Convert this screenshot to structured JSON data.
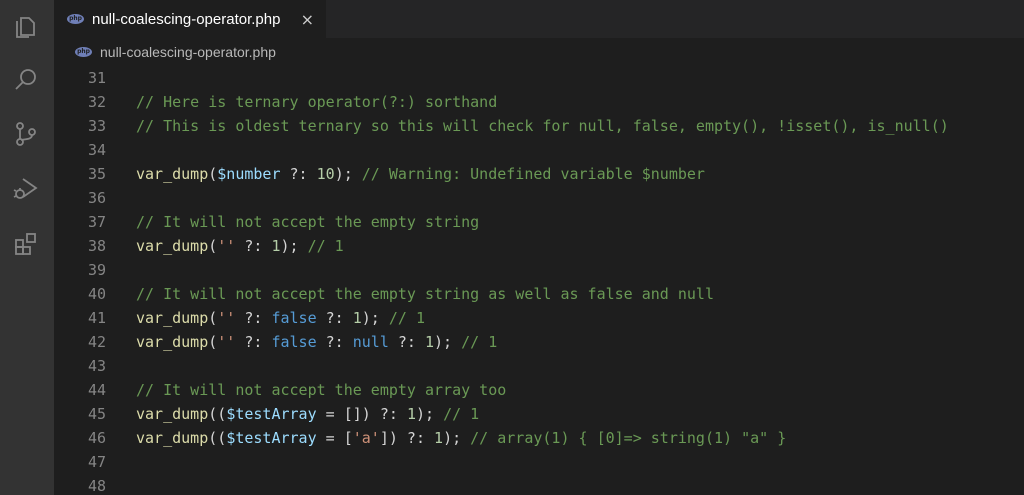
{
  "activity_bar": {
    "icons": [
      "files-icon",
      "search-icon",
      "source-control-icon",
      "run-debug-icon",
      "extensions-icon"
    ]
  },
  "tab": {
    "label": "null-coalescing-operator.php",
    "file_icon_text": "php",
    "close": "×"
  },
  "breadcrumb": {
    "label": "null-coalescing-operator.php",
    "file_icon_text": "php"
  },
  "colors": {
    "comment": "#6a9955",
    "function": "#dcdcaa",
    "variable": "#9cdcfe",
    "number": "#b5cea8",
    "string": "#ce9178",
    "keyword": "#569cd6",
    "text": "#d4d4d4",
    "line_number": "#858585"
  },
  "editor": {
    "lines": [
      {
        "num": "31",
        "tokens": []
      },
      {
        "num": "32",
        "tokens": [
          {
            "t": "comment",
            "v": "// Here is ternary operator(?:) sorthand"
          }
        ]
      },
      {
        "num": "33",
        "tokens": [
          {
            "t": "comment",
            "v": "// This is oldest ternary so this will check for null, false, empty(), !isset(), is_null()"
          }
        ]
      },
      {
        "num": "34",
        "tokens": []
      },
      {
        "num": "35",
        "tokens": [
          {
            "t": "func",
            "v": "var_dump"
          },
          {
            "t": "punc",
            "v": "("
          },
          {
            "t": "var",
            "v": "$number"
          },
          {
            "t": "punc",
            "v": " ?: "
          },
          {
            "t": "num",
            "v": "10"
          },
          {
            "t": "punc",
            "v": "); "
          },
          {
            "t": "comment",
            "v": "// Warning: Undefined variable $number"
          }
        ]
      },
      {
        "num": "36",
        "tokens": []
      },
      {
        "num": "37",
        "tokens": [
          {
            "t": "comment",
            "v": "// It will not accept the empty string"
          }
        ]
      },
      {
        "num": "38",
        "tokens": [
          {
            "t": "func",
            "v": "var_dump"
          },
          {
            "t": "punc",
            "v": "("
          },
          {
            "t": "str",
            "v": "''"
          },
          {
            "t": "punc",
            "v": " ?: "
          },
          {
            "t": "num",
            "v": "1"
          },
          {
            "t": "punc",
            "v": "); "
          },
          {
            "t": "comment",
            "v": "// 1"
          }
        ]
      },
      {
        "num": "39",
        "tokens": []
      },
      {
        "num": "40",
        "tokens": [
          {
            "t": "comment",
            "v": "// It will not accept the empty string as well as false and null"
          }
        ]
      },
      {
        "num": "41",
        "tokens": [
          {
            "t": "func",
            "v": "var_dump"
          },
          {
            "t": "punc",
            "v": "("
          },
          {
            "t": "str",
            "v": "''"
          },
          {
            "t": "punc",
            "v": " ?: "
          },
          {
            "t": "kw",
            "v": "false"
          },
          {
            "t": "punc",
            "v": " ?: "
          },
          {
            "t": "num",
            "v": "1"
          },
          {
            "t": "punc",
            "v": "); "
          },
          {
            "t": "comment",
            "v": "// 1"
          }
        ]
      },
      {
        "num": "42",
        "tokens": [
          {
            "t": "func",
            "v": "var_dump"
          },
          {
            "t": "punc",
            "v": "("
          },
          {
            "t": "str",
            "v": "''"
          },
          {
            "t": "punc",
            "v": " ?: "
          },
          {
            "t": "kw",
            "v": "false"
          },
          {
            "t": "punc",
            "v": " ?: "
          },
          {
            "t": "kw",
            "v": "null"
          },
          {
            "t": "punc",
            "v": " ?: "
          },
          {
            "t": "num",
            "v": "1"
          },
          {
            "t": "punc",
            "v": "); "
          },
          {
            "t": "comment",
            "v": "// 1"
          }
        ]
      },
      {
        "num": "43",
        "tokens": []
      },
      {
        "num": "44",
        "tokens": [
          {
            "t": "comment",
            "v": "// It will not accept the empty array too"
          }
        ]
      },
      {
        "num": "45",
        "tokens": [
          {
            "t": "func",
            "v": "var_dump"
          },
          {
            "t": "punc",
            "v": "(("
          },
          {
            "t": "var",
            "v": "$testArray"
          },
          {
            "t": "punc",
            "v": " = []) ?: "
          },
          {
            "t": "num",
            "v": "1"
          },
          {
            "t": "punc",
            "v": "); "
          },
          {
            "t": "comment",
            "v": "// 1"
          }
        ]
      },
      {
        "num": "46",
        "tokens": [
          {
            "t": "func",
            "v": "var_dump"
          },
          {
            "t": "punc",
            "v": "(("
          },
          {
            "t": "var",
            "v": "$testArray"
          },
          {
            "t": "punc",
            "v": " = ["
          },
          {
            "t": "str",
            "v": "'a'"
          },
          {
            "t": "punc",
            "v": "]) ?: "
          },
          {
            "t": "num",
            "v": "1"
          },
          {
            "t": "punc",
            "v": "); "
          },
          {
            "t": "comment",
            "v": "// array(1) { [0]=> string(1) \"a\" }"
          }
        ]
      },
      {
        "num": "47",
        "tokens": []
      },
      {
        "num": "48",
        "tokens": []
      }
    ]
  }
}
